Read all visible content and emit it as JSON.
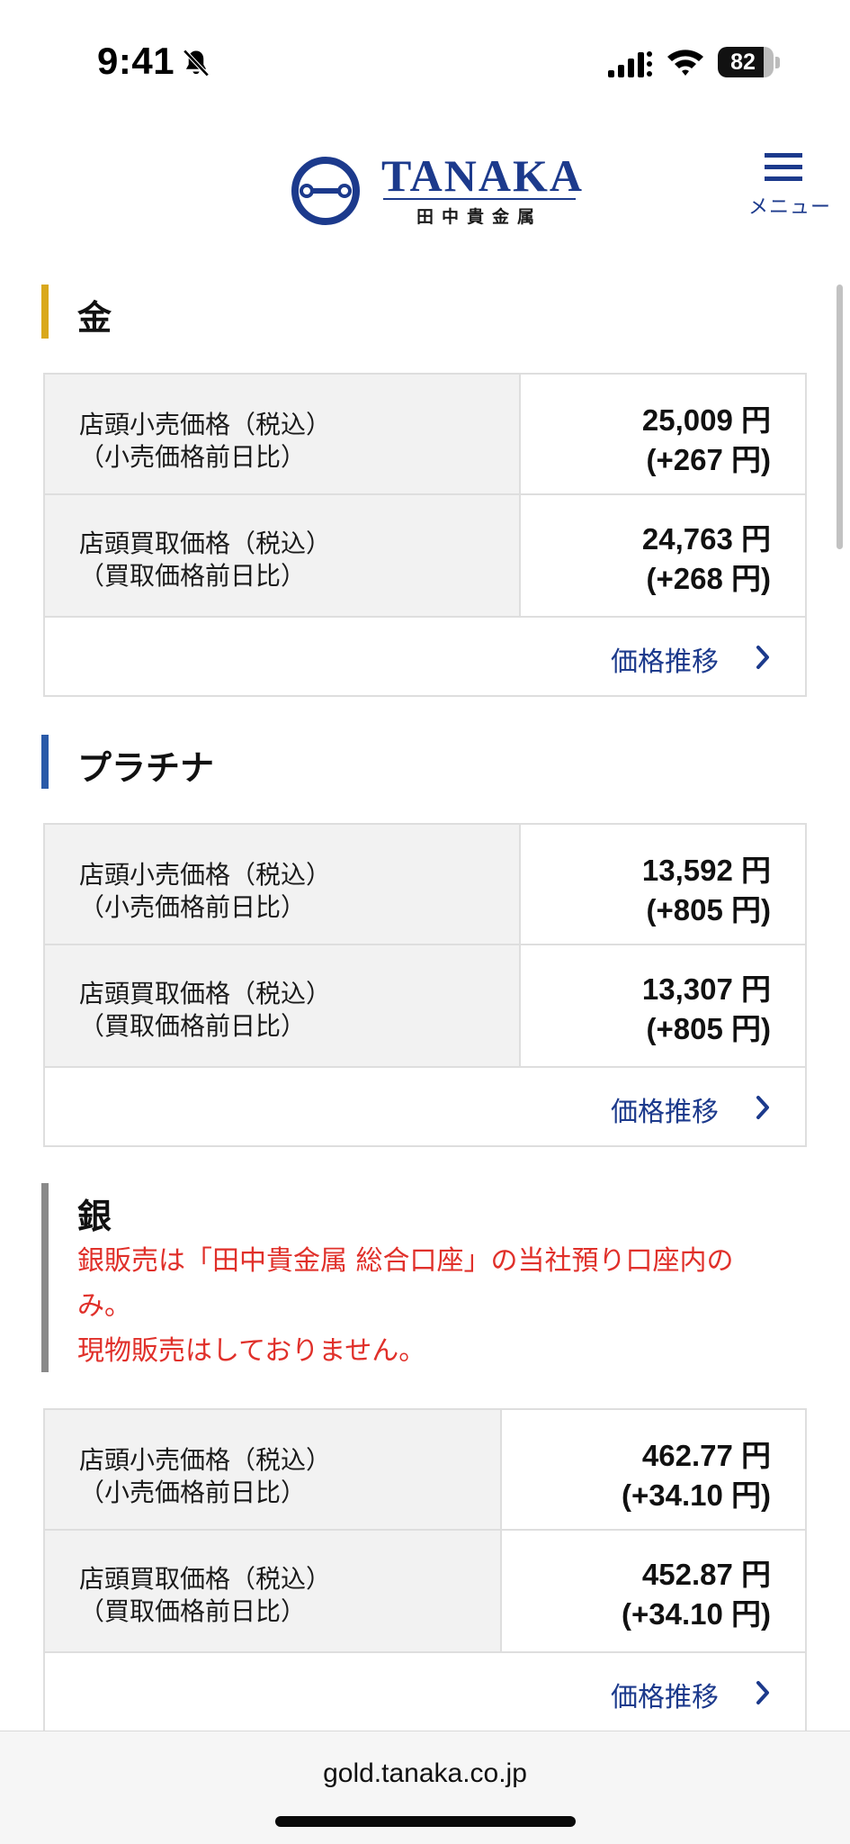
{
  "status_bar": {
    "time": "9:41",
    "battery_text": "82",
    "battery_level": 0.82
  },
  "header": {
    "logo_word": "TANAKA",
    "logo_sub": "田中貴金属",
    "menu_label": "メニュー",
    "brand_color": "#1c3a8c"
  },
  "sections": [
    {
      "title": "金",
      "accent": "#d9a81c",
      "rows": [
        {
          "label_line1": "店頭小売価格（税込）",
          "label_line2": "（小売価格前日比）",
          "value": "25,009 円",
          "change": "(+267 円)"
        },
        {
          "label_line1": "店頭買取価格（税込）",
          "label_line2": "（買取価格前日比）",
          "value": "24,763 円",
          "change": "(+268 円)"
        }
      ],
      "trend_label": "価格推移"
    },
    {
      "title": "プラチナ",
      "accent": "#2a5aa8",
      "rows": [
        {
          "label_line1": "店頭小売価格（税込）",
          "label_line2": "（小売価格前日比）",
          "value": "13,592 円",
          "change": "(+805 円)"
        },
        {
          "label_line1": "店頭買取価格（税込）",
          "label_line2": "（買取価格前日比）",
          "value": "13,307 円",
          "change": "(+805 円)"
        }
      ],
      "trend_label": "価格推移"
    },
    {
      "title": "銀",
      "accent": "#8a8a8a",
      "notice_line1": "銀販売は「田中貴金属 総合口座」の当社預り口座内の",
      "notice_line2": "み。",
      "notice_line3": "現物販売はしておりません。",
      "rows": [
        {
          "label_line1": "店頭小売価格（税込）",
          "label_line2": "（小売価格前日比）",
          "value": "462.77 円",
          "change": "(+34.10 円)"
        },
        {
          "label_line1": "店頭買取価格（税込）",
          "label_line2": "（買取価格前日比）",
          "value": "452.87 円",
          "change": "(+34.10 円)"
        }
      ],
      "trend_label": "価格推移"
    }
  ],
  "browser": {
    "url": "gold.tanaka.co.jp"
  }
}
